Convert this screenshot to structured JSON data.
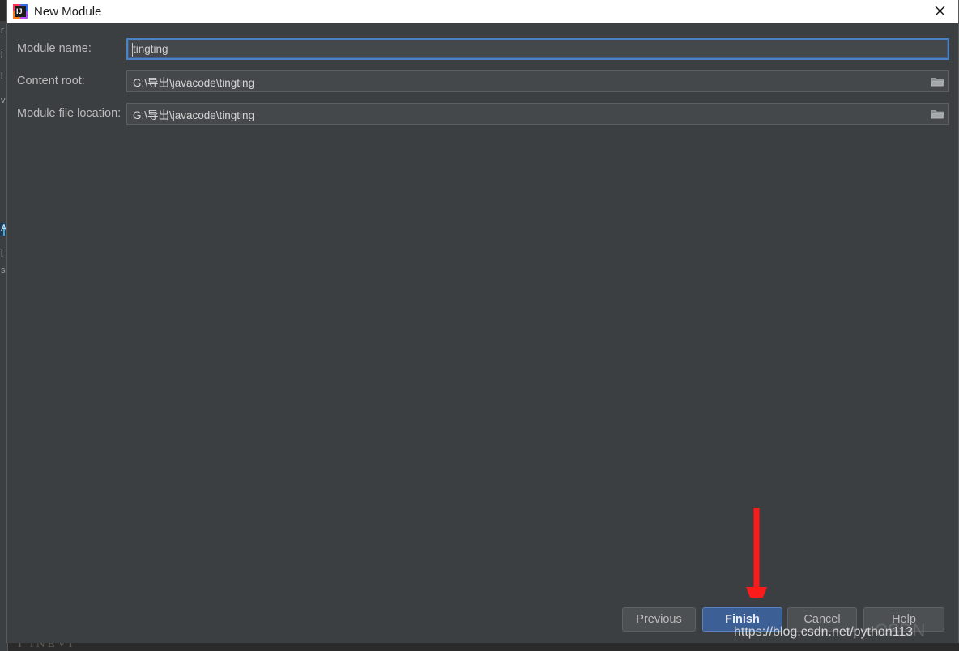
{
  "window": {
    "title": "New Module",
    "app_icon": "intellij-idea-icon",
    "close_label": "×"
  },
  "form": {
    "rows": [
      {
        "label": "Module name:",
        "value": "tingting",
        "focused": true,
        "has_browse": false,
        "browse_icon": ""
      },
      {
        "label": "Content root:",
        "value": "G:\\导出\\javacode\\tingting",
        "focused": false,
        "has_browse": true,
        "browse_icon": "folder-icon"
      },
      {
        "label": "Module file location:",
        "value": "G:\\导出\\javacode\\tingting",
        "focused": false,
        "has_browse": true,
        "browse_icon": "folder-icon"
      }
    ]
  },
  "buttons": [
    {
      "label": "Previous",
      "primary": false
    },
    {
      "label": "Finish",
      "primary": true
    },
    {
      "label": "Cancel",
      "primary": false
    },
    {
      "label": "Help",
      "primary": false
    }
  ],
  "annotation": {
    "type": "red-arrow-down",
    "color": "#fb1b1b",
    "points_at": "Finish"
  },
  "watermark": {
    "url": "https://blog.csdn.net/python113",
    "logo": "CSDN"
  },
  "backdrop": {
    "bottom_text": "I INEVI",
    "fragments": [
      "r",
      "j",
      "l",
      "v",
      "A",
      "[",
      "s"
    ]
  },
  "colors": {
    "dialog_bg": "#3c3f41",
    "titlebar_bg": "#ffffff",
    "field_bg": "#45484a",
    "focus_border": "#4b82c3",
    "primary_button": "#3c6096",
    "text": "#bbbbbb",
    "arrow": "#fb1b1b"
  }
}
